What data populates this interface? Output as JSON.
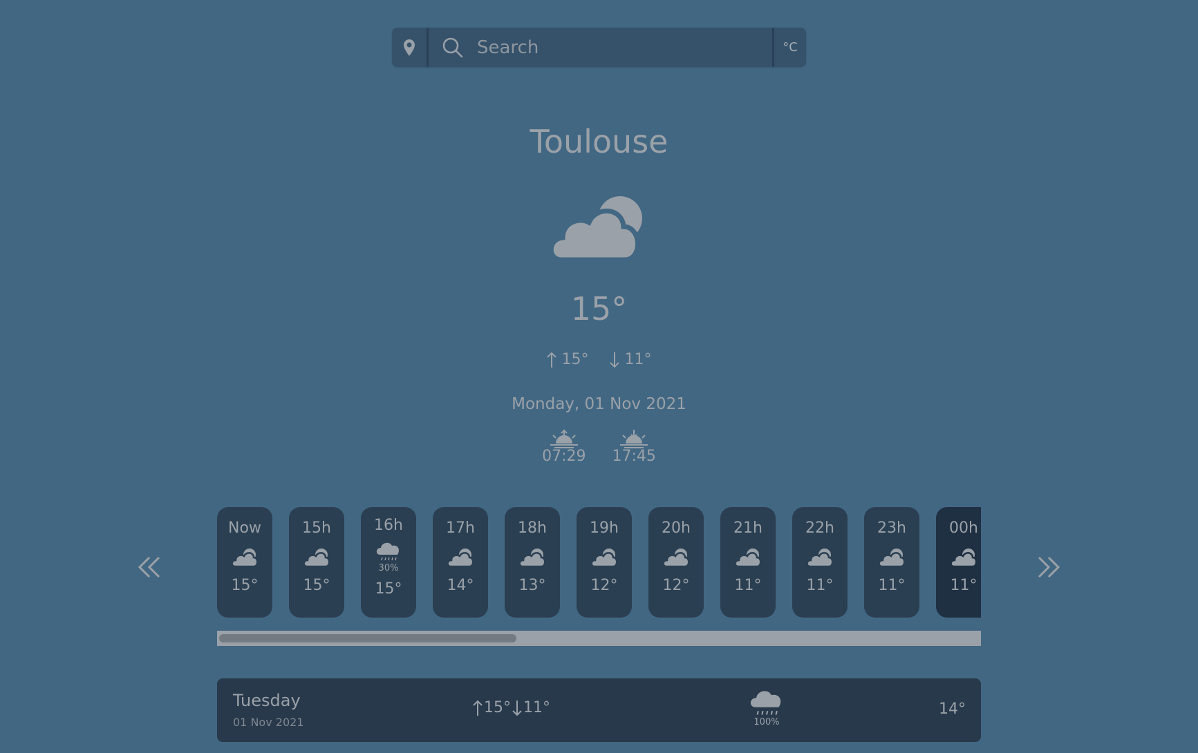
{
  "search": {
    "placeholder": "Search",
    "unit": "°C"
  },
  "current": {
    "city": "Toulouse",
    "temperature": "15°",
    "high": "15°",
    "low": "11°",
    "date": "Monday, 01 Nov 2021",
    "sunrise": "07:29",
    "sunset": "17:45",
    "icon": "partly-cloudy-icon"
  },
  "hourly": [
    {
      "time": "Now",
      "icon": "cloudy-icon",
      "temp": "15°"
    },
    {
      "time": "15h",
      "icon": "cloudy-icon",
      "temp": "15°"
    },
    {
      "time": "16h",
      "icon": "rain-icon",
      "precip": "30%",
      "temp": "15°"
    },
    {
      "time": "17h",
      "icon": "cloudy-icon",
      "temp": "14°"
    },
    {
      "time": "18h",
      "icon": "cloudy-icon",
      "temp": "13°"
    },
    {
      "time": "19h",
      "icon": "cloudy-icon",
      "temp": "12°"
    },
    {
      "time": "20h",
      "icon": "cloudy-icon",
      "temp": "12°"
    },
    {
      "time": "21h",
      "icon": "cloudy-icon",
      "temp": "11°"
    },
    {
      "time": "22h",
      "icon": "cloudy-icon",
      "temp": "11°"
    },
    {
      "time": "23h",
      "icon": "cloudy-icon",
      "temp": "11°"
    },
    {
      "time": "00h",
      "icon": "cloudy-icon",
      "temp": "11°"
    }
  ],
  "daily": [
    {
      "day": "Tuesday",
      "date": "01 Nov 2021",
      "high": "15°",
      "low": "11°",
      "icon": "rain-icon",
      "precip": "100%",
      "temp": "14°"
    }
  ],
  "colors": {
    "background": "#426783",
    "card": "#2b3f52",
    "text": "#9aa1a8"
  }
}
